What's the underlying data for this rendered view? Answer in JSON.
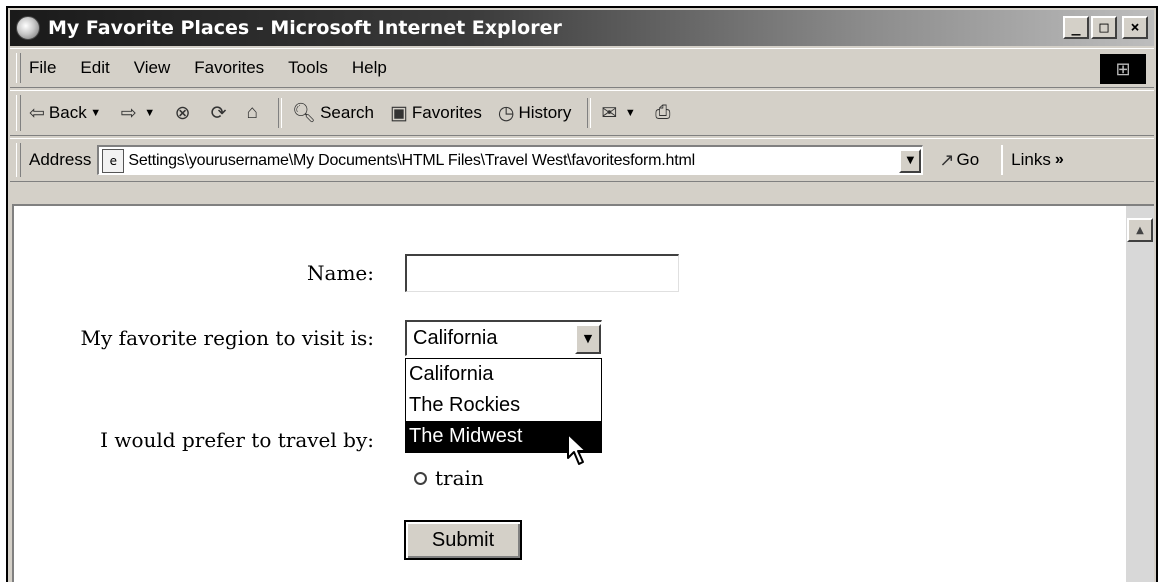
{
  "window": {
    "title": "My Favorite Places - Microsoft Internet Explorer",
    "controls": {
      "minimize": "_",
      "maximize": "□",
      "close": "×"
    }
  },
  "menubar": {
    "items": [
      "File",
      "Edit",
      "View",
      "Favorites",
      "Tools",
      "Help"
    ]
  },
  "toolbar": {
    "back_label": "Back",
    "search_label": "Search",
    "favorites_label": "Favorites",
    "history_label": "History"
  },
  "addressbar": {
    "label": "Address",
    "url": "Settings\\yourusername\\My Documents\\HTML Files\\Travel West\\favoritesform.html",
    "go_label": "Go",
    "links_label": "Links"
  },
  "form": {
    "name_label": "Name:",
    "name_value": "",
    "region_label": "My favorite region to visit is:",
    "region_selected": "California",
    "region_options": [
      "California",
      "The Rockies",
      "The Midwest"
    ],
    "region_highlighted": "The Midwest",
    "travel_label": "I would prefer to travel by:",
    "travel_option_visible": "train",
    "submit_label": "Submit"
  }
}
